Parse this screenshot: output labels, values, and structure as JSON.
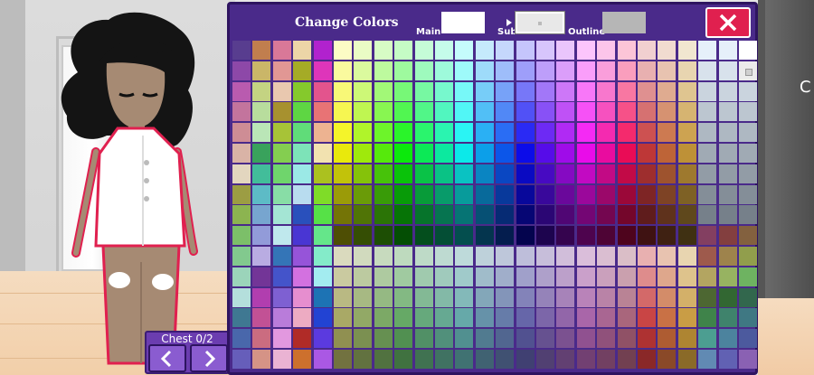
{
  "panel": {
    "title": "Change Colors",
    "main_label": "Main",
    "sub_label": "Sub",
    "outline_label": "Outline",
    "main_color": "#ffffff",
    "sub_color": "#e8e8e8",
    "outline_color": "#b6b6b6",
    "close_icon": "close-icon",
    "accent_color": "#4a2a8a",
    "close_color": "#e0204f"
  },
  "chest_nav": {
    "label": "Chest 0/2",
    "prev_icon": "chevron-left-icon",
    "next_icon": "chevron-right-icon"
  },
  "peek_text": "C",
  "character": {
    "skin": "#a68a73",
    "hair": "#141414",
    "outfit": "#ffffff",
    "outline": "#e0204f"
  }
}
